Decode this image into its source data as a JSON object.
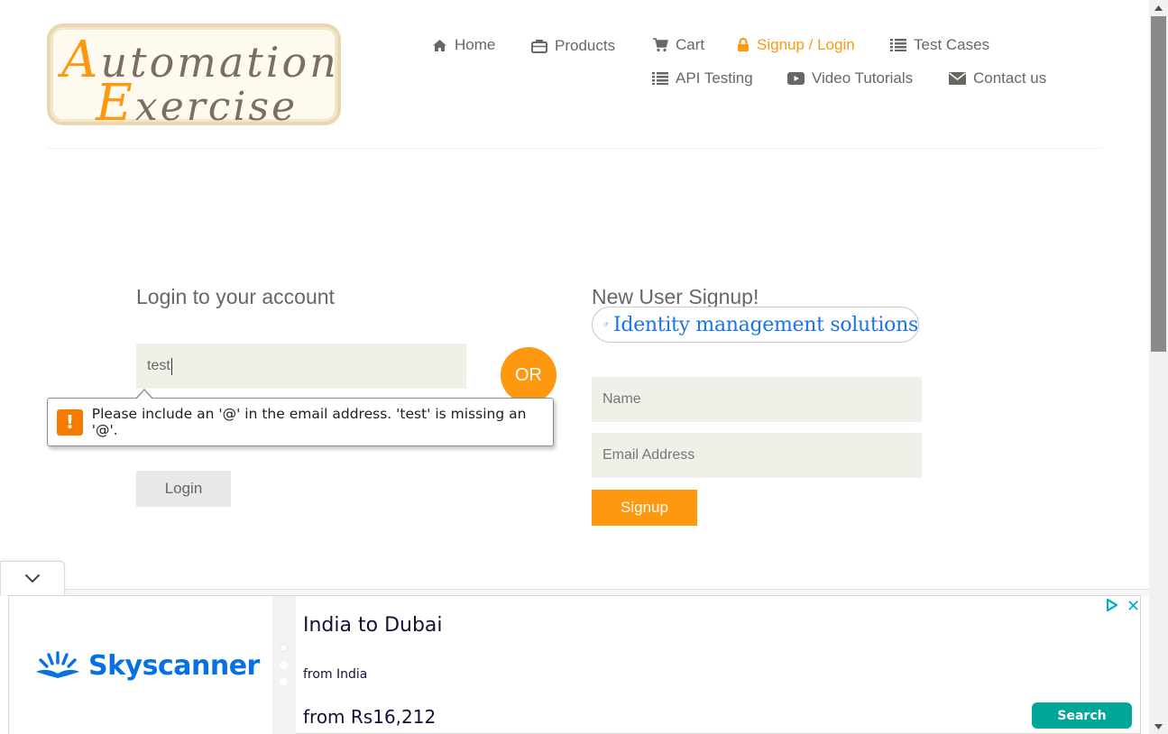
{
  "logo": {
    "line1_cap": "A",
    "line1_rest": "utomation",
    "line2_cap": "E",
    "line2_rest": "xercise"
  },
  "nav": {
    "items": [
      {
        "label": "Home",
        "icon": "home-icon"
      },
      {
        "label": "Products",
        "icon": "briefcase-icon"
      },
      {
        "label": "Cart",
        "icon": "cart-icon"
      },
      {
        "label": "Signup / Login",
        "icon": "lock-icon",
        "active": true
      },
      {
        "label": "Test Cases",
        "icon": "list-icon"
      },
      {
        "label": "API Testing",
        "icon": "list-icon"
      },
      {
        "label": "Video Tutorials",
        "icon": "youtube-icon"
      },
      {
        "label": "Contact us",
        "icon": "envelope-icon"
      }
    ]
  },
  "login": {
    "title": "Login to your account",
    "email_value": "test",
    "button": "Login"
  },
  "or_label": "OR",
  "validation": {
    "message": "Please include an '@' in the email address. 'test' is missing an '@'."
  },
  "signup": {
    "title": "New User Signup!",
    "name_placeholder": "Name",
    "email_placeholder": "Email Address",
    "button": "Signup"
  },
  "overlay_ad_link": {
    "text": "Identity management solutions",
    "icon": "tag-icon"
  },
  "ad": {
    "brand": "Skyscanner",
    "headline": "India to Dubai",
    "from_label": "from India",
    "price": "from Rs16,212",
    "cta": "Search",
    "close": "✕"
  },
  "colors": {
    "accent": "#fe980f",
    "field_bg": "#f0f0e9",
    "text": "#696763",
    "link_blue": "#1a73e8",
    "sky_blue": "#0770e3",
    "ad_cta": "#00a698"
  }
}
